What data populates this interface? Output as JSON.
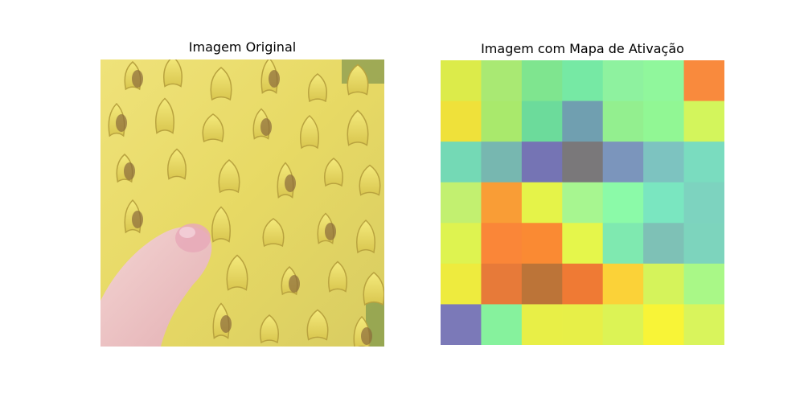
{
  "panels": {
    "left_title": "Imagem Original",
    "right_title": "Imagem com Mapa de Ativação"
  },
  "heatmap": {
    "rows": 7,
    "cols": 7,
    "colors": [
      [
        "#dceb4a",
        "#a9e973",
        "#7fe58f",
        "#76e9a4",
        "#8ef29f",
        "#90f79c",
        "#f98a3d"
      ],
      [
        "#efe13a",
        "#a9e96c",
        "#6cdb9b",
        "#709fb0",
        "#93ef8f",
        "#91f794",
        "#d3f55c"
      ],
      [
        "#74d9b5",
        "#77b7b0",
        "#7574b4",
        "#7a787a",
        "#7b95bc",
        "#7dc3c0",
        "#7adcbf"
      ],
      [
        "#c2f070",
        "#f99d36",
        "#e5f349",
        "#a7f690",
        "#8bfaa8",
        "#7ae6c0",
        "#7dd3bf"
      ],
      [
        "#def350",
        "#fa8638",
        "#fa8a33",
        "#e5f64b",
        "#7fe9b0",
        "#7ec1b6",
        "#7dd4bd"
      ],
      [
        "#eeeb3e",
        "#e77a39",
        "#bc7438",
        "#ef7a34",
        "#fbd238",
        "#d5f35b",
        "#a9f887"
      ],
      [
        "#7b79b8",
        "#86f29d",
        "#e8ef47",
        "#e7ef48",
        "#dcf355",
        "#f8f437",
        "#d9f45c"
      ]
    ]
  }
}
